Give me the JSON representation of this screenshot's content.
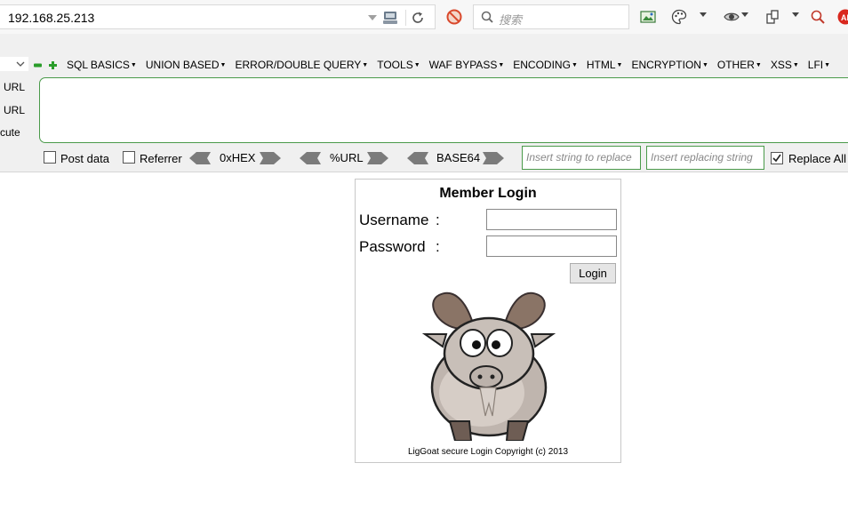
{
  "address_bar": {
    "url": "192.168.25.213",
    "search_placeholder": "搜索"
  },
  "hackbar": {
    "menu": [
      "SQL BASICS",
      "UNION BASED",
      "ERROR/DOUBLE QUERY",
      "TOOLS",
      "WAF BYPASS",
      "ENCODING",
      "HTML",
      "ENCRYPTION",
      "OTHER",
      "XSS",
      "LFI"
    ],
    "side_actions": [
      "URL",
      "URL",
      "cute"
    ],
    "post_data_label": "Post data",
    "referrer_label": "Referrer",
    "hex_label": "0xHEX",
    "url_label": "%URL",
    "base64_label": "BASE64",
    "find_placeholder": "Insert string to replace",
    "replace_placeholder": "Insert replacing string",
    "replace_all_label": "Replace All",
    "replace_all_checked": true
  },
  "login": {
    "title": "Member Login",
    "username_label": "Username",
    "password_label": "Password",
    "colon": ":",
    "button_label": "Login",
    "footer": "LigGoat secure Login Copyright (c) 2013"
  }
}
